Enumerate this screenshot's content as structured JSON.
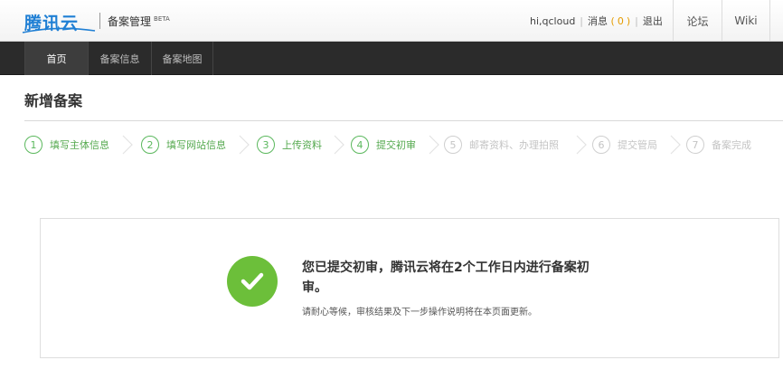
{
  "header": {
    "logo_text": "腾讯云",
    "product_name": "备案管理",
    "product_badge": "BETA",
    "user": {
      "greeting": "hi,qcloud",
      "messages_label": "消息",
      "messages_open": "(",
      "messages_count": "0",
      "messages_close": ")",
      "logout_label": "退出"
    },
    "links": {
      "forum": "论坛",
      "wiki": "Wiki"
    }
  },
  "nav": {
    "items": [
      {
        "label": "首页",
        "active": true
      },
      {
        "label": "备案信息",
        "active": false
      },
      {
        "label": "备案地图",
        "active": false
      }
    ]
  },
  "page": {
    "title": "新增备案"
  },
  "steps": [
    {
      "num": "1",
      "label": "填写主体信息",
      "state": "done"
    },
    {
      "num": "2",
      "label": "填写网站信息",
      "state": "done"
    },
    {
      "num": "3",
      "label": "上传资料",
      "state": "done"
    },
    {
      "num": "4",
      "label": "提交初审",
      "state": "current"
    },
    {
      "num": "5",
      "label": "邮寄资料、办理拍照",
      "state": "pending"
    },
    {
      "num": "6",
      "label": "提交管局",
      "state": "pending"
    },
    {
      "num": "7",
      "label": "备案完成",
      "state": "pending"
    }
  ],
  "result": {
    "message": "您已提交初审，腾讯云将在2个工作日内进行备案初审。",
    "note": "请耐心等候，审核结果及下一步操作说明将在本页面更新。"
  },
  "colors": {
    "accent_green": "#5bb85d",
    "check_green": "#6cbf3a",
    "logo_blue": "#1f7fd4",
    "nav_bg": "#2b2b2b",
    "messages_orange": "#e59c00",
    "inactive_gray": "#c4c4c4"
  }
}
